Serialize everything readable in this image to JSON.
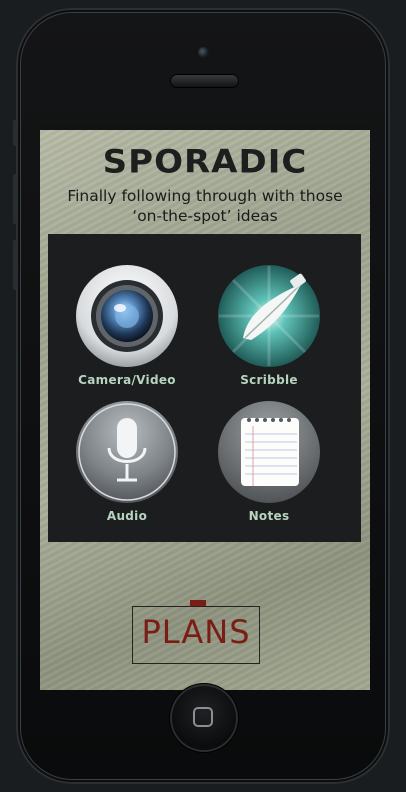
{
  "app": {
    "title": "SPORADIC",
    "subtitle_line1": "Finally following through with those",
    "subtitle_line2": "‘on-the-spot’ ideas"
  },
  "tiles": [
    {
      "label": "Camera/Video",
      "icon": "camera-lens-icon"
    },
    {
      "label": "Scribble",
      "icon": "quill-icon"
    },
    {
      "label": "Audio",
      "icon": "microphone-icon"
    },
    {
      "label": "Notes",
      "icon": "notepad-icon"
    }
  ],
  "plans": {
    "label": "PLANS"
  },
  "colors": {
    "label_text": "#b8d4c0",
    "plans_accent": "#7a1d14",
    "panel_bg": "#1b1d1e"
  }
}
